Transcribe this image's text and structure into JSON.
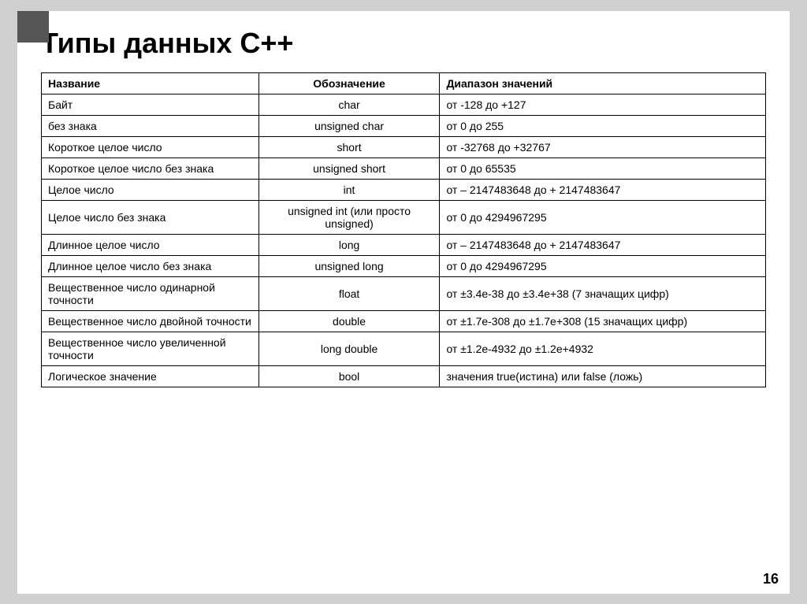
{
  "title": "Типы данных С++",
  "page_number": "16",
  "table": {
    "headers": [
      "Название",
      "Обозначение",
      "Диапазон значений"
    ],
    "rows": [
      [
        "Байт",
        "char",
        "от -128 до +127"
      ],
      [
        "без знака",
        "unsigned char",
        "от 0 до 255"
      ],
      [
        "Короткое целое число",
        "short",
        "от -32768 до +32767"
      ],
      [
        "Короткое целое число без знака",
        "unsigned short",
        "от 0 до 65535"
      ],
      [
        "Целое число",
        "int",
        "от – 2147483648 до + 2147483647"
      ],
      [
        "Целое число без знака",
        "unsigned int (или просто unsigned)",
        "от 0 до 4294967295"
      ],
      [
        "Длинное целое число",
        "long",
        "от – 2147483648 до + 2147483647"
      ],
      [
        "Длинное целое число без знака",
        "unsigned long",
        "от 0 до 4294967295"
      ],
      [
        "Вещественное число одинарной точности",
        "float",
        "от ±3.4е-38 до ±3.4е+38 (7 значащих цифр)"
      ],
      [
        "Вещественное число двойной точности",
        "double",
        "от ±1.7е-308 до ±1.7е+308 (15 значащих цифр)"
      ],
      [
        "Вещественное число увеличенной точности",
        "long double",
        "от ±1.2е-4932 до ±1.2е+4932"
      ],
      [
        "Логическое значение",
        "bool",
        "значения true(истина) или false (ложь)"
      ]
    ]
  }
}
